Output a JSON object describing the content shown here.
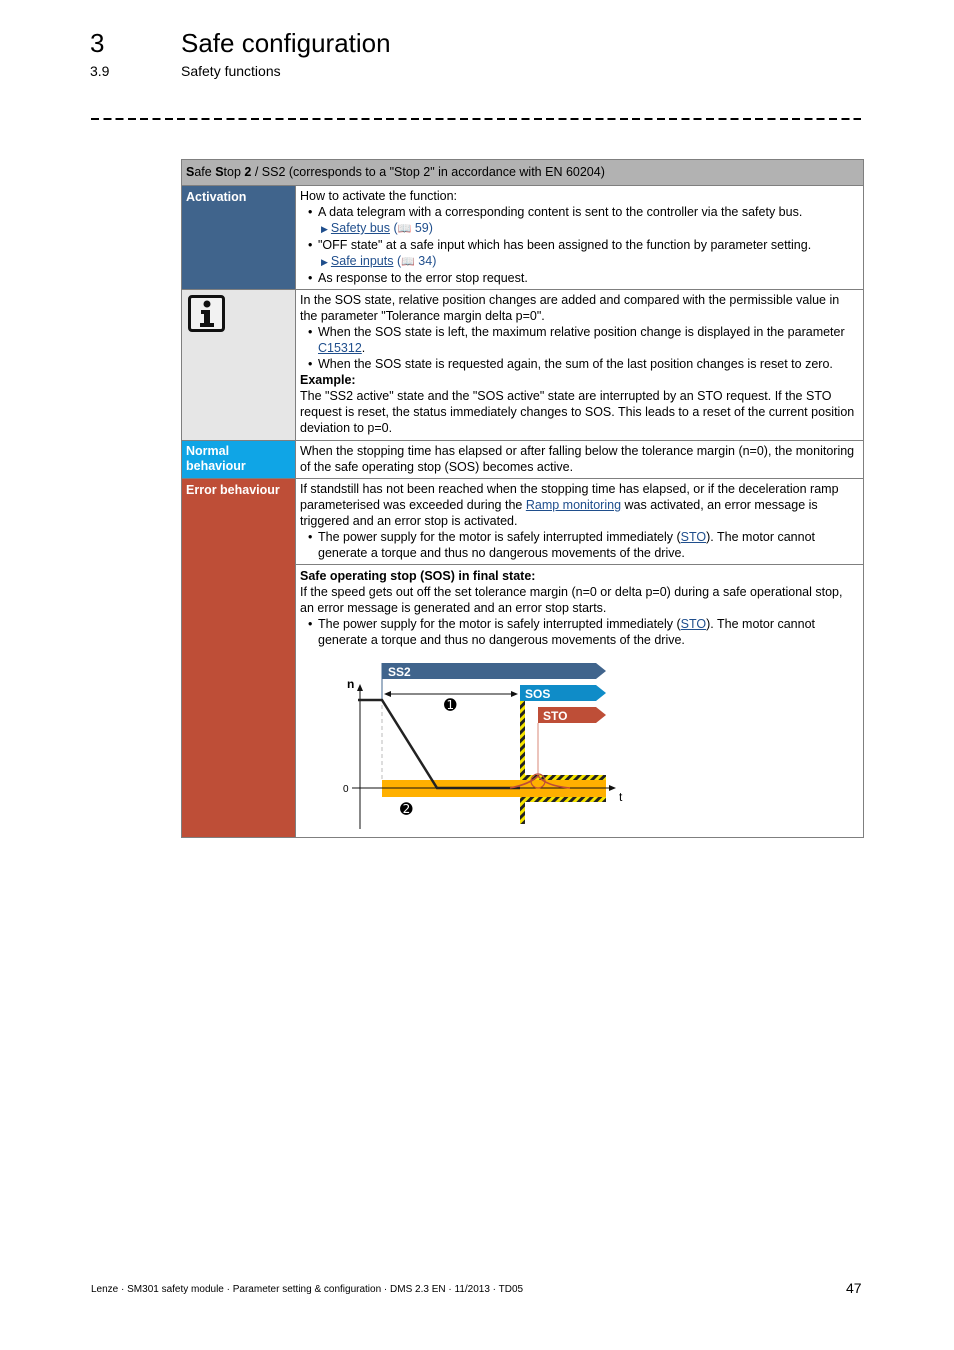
{
  "header": {
    "chapter_number": "3",
    "chapter_title": "Safe configuration",
    "section_number": "3.9",
    "section_title": "Safety functions"
  },
  "table": {
    "title_parts": {
      "s1": "S",
      "afe": "afe ",
      "s2": "S",
      "top": "top ",
      "two": "2",
      "rest": " / SS2 (corresponds to a \"Stop 2\" in accordance with EN 60204)"
    },
    "activation": {
      "label": "Activation",
      "intro": "How to activate the function:",
      "bullet1": "A data telegram with a corresponding content is sent to the controller via the safety bus.",
      "link1": {
        "text": "Safety bus",
        "open": " (",
        "book_icon": "book-icon",
        "page": " 59",
        "close": ")"
      },
      "bullet2": "\"OFF state\" at a safe input which has been assigned to the function by parameter setting.",
      "link2": {
        "text": "Safe inputs",
        "open": " (",
        "page": " 34",
        "close": ")"
      },
      "bullet3": "As response to the error stop request."
    },
    "info": {
      "icon": "info-icon",
      "para": "In the SOS state, relative position changes are added and compared with the permissible value in the parameter \"Tolerance margin delta p=0\".",
      "bullet1_pre": "When the SOS state is left, the maximum relative position change is displayed in the parameter ",
      "bullet1_link": "C15312",
      "bullet1_post": ".",
      "bullet2": "When the SOS state is requested again, the sum of the last position changes is reset to zero.",
      "example_label": "Example:",
      "example_text": "The \"SS2 active\" state and the \"SOS active\" state are interrupted by an STO request. If the STO request is reset, the status immediately changes to SOS. This leads to a reset of the current position deviation to p=0."
    },
    "normal": {
      "label": "Normal behaviour",
      "text": "When the stopping time has elapsed or after falling below the tolerance margin (n=0), the monitoring of the safe operating stop (SOS) becomes active."
    },
    "error": {
      "label": "Error behaviour",
      "para_pre": "If standstill has not been reached when the stopping time has elapsed, or if the deceleration ramp parameterised was exceeded during the ",
      "para_link": "Ramp monitoring",
      "para_post": " was activated, an error message is triggered and an error stop is activated.",
      "bullet_pre": "The power supply for the motor is safely interrupted immediately (",
      "bullet_link": "STO",
      "bullet_post": "). The motor cannot generate a torque and thus no dangerous movements of the drive.",
      "sos_heading": "Safe operating stop (SOS) in final state:",
      "sos_text": "If the speed gets out off the set tolerance margin (n=0 or delta p=0) during a safe operational stop, an error message is generated and an error stop starts.",
      "sos_bullet_pre": "The power supply for the motor is safely interrupted immediately (",
      "sos_bullet_link": "STO",
      "sos_bullet_post": "). The motor cannot generate a torque and thus no dangerous movements of the drive."
    },
    "diagram": {
      "bars": [
        {
          "label": "SS2",
          "color": "#40648c"
        },
        {
          "label": "SOS",
          "color": "#0f8cc8"
        },
        {
          "label": "STO",
          "color": "#be4e37"
        }
      ],
      "y_axis_label": "n",
      "x_axis_label": "t",
      "zero_label": "0",
      "marker1": "➊",
      "marker2": "➋",
      "tolerance_color": "#ffb000"
    }
  },
  "footer": {
    "text": "Lenze · SM301 safety module · Parameter setting & configuration · DMS 2.3 EN · 11/2013 · TD05",
    "page": "47"
  }
}
